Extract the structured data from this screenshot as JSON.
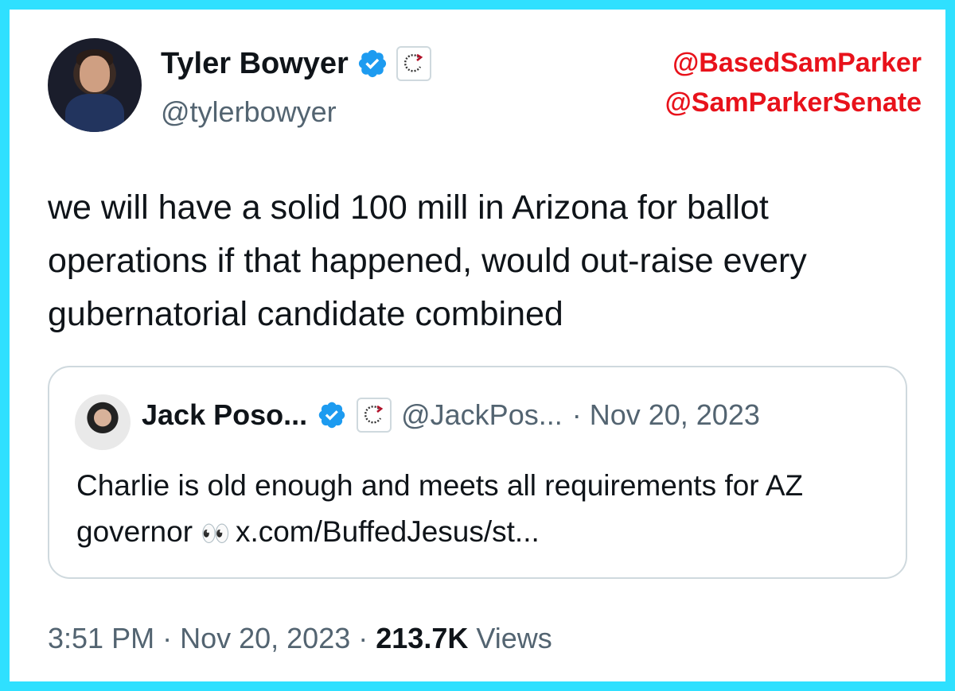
{
  "author": {
    "display_name": "Tyler Bowyer",
    "handle": "@tylerbowyer"
  },
  "watermark": {
    "line1": "@BasedSamParker",
    "line2": "@SamParkerSenate"
  },
  "tweet": {
    "text": "we will have a solid 100 mill in Arizona for ballot operations if that happened, would out-raise every gubernatorial candidate combined",
    "time": "3:51 PM",
    "date": "Nov 20, 2023",
    "views_count": "213.7K",
    "views_label": "Views"
  },
  "quoted": {
    "display_name": "Jack Poso...",
    "handle": "@JackPos...",
    "date": "· Nov 20, 2023",
    "text_main": "Charlie is old enough and meets all requirements for AZ governor",
    "emoji": "👀",
    "link": "x.com/BuffedJesus/st..."
  },
  "colors": {
    "frame": "#2fe0ff",
    "verified": "#1d9bf0",
    "watermark": "#e8121b",
    "secondary_text": "#536471"
  }
}
